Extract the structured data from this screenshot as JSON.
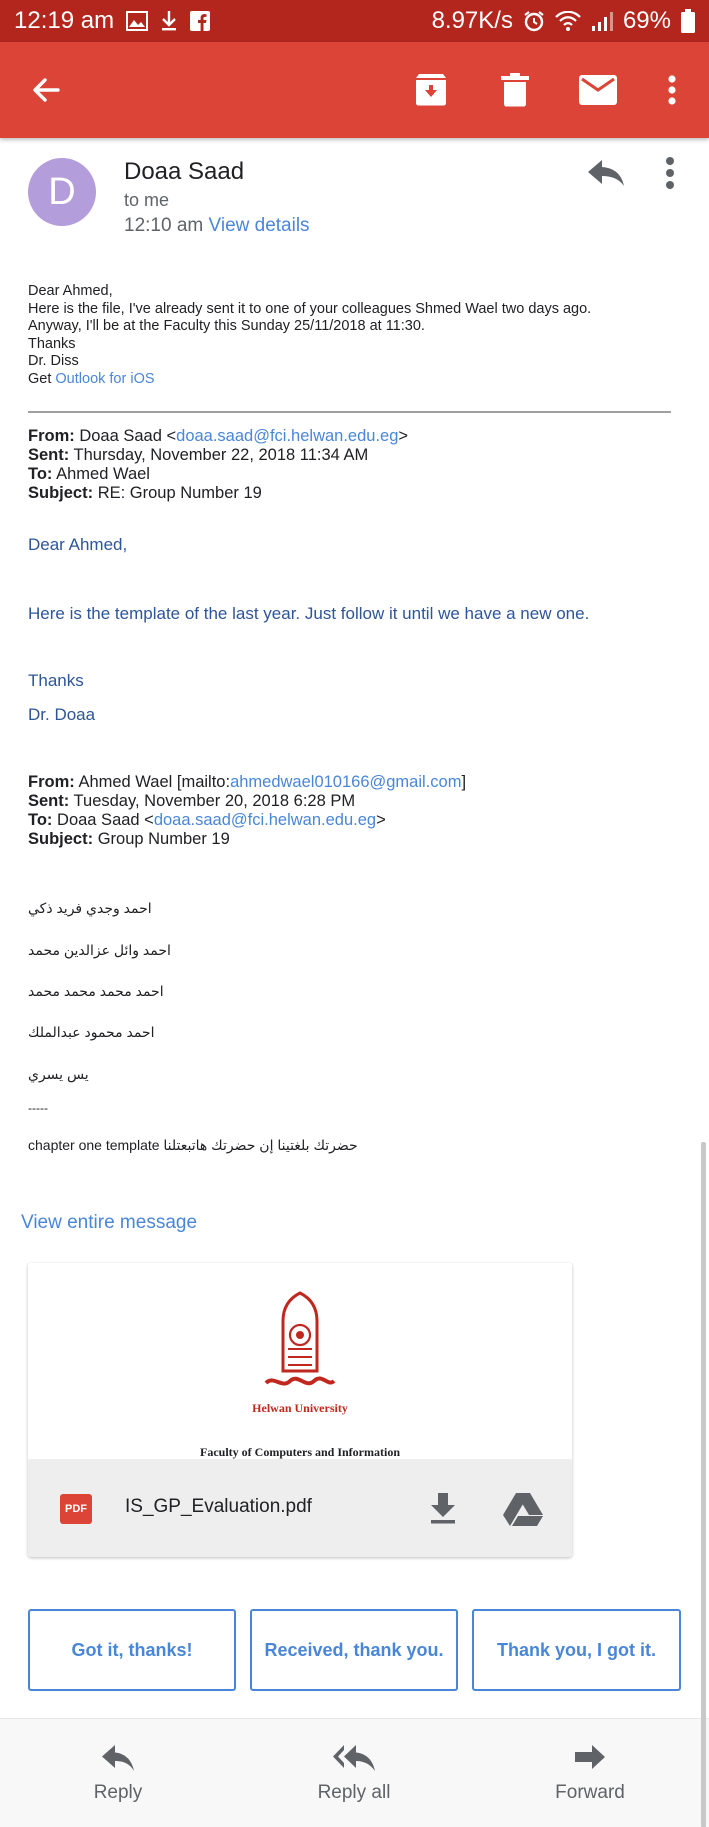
{
  "status_bar": {
    "time": "12:19 am",
    "network_speed": "8.97K/s",
    "battery": "69%"
  },
  "app_bar": {
    "icons": [
      "back-arrow-icon",
      "archive-icon",
      "delete-icon",
      "mail-icon",
      "more-vert-icon"
    ]
  },
  "header": {
    "avatar_letter": "D",
    "avatar_color": "#b39ddb",
    "sender": "Doaa Saad",
    "recipient": "to me",
    "time": "12:10 am",
    "view_details": "View details"
  },
  "reply_body": {
    "greeting": "Dear Ahmed,",
    "line1": "Here is the file, I've already sent it to one of your colleagues Shmed Wael two days ago.",
    "line2": "Anyway, I'll be at the Faculty this Sunday 25/11/2018 at 11:30.",
    "thanks": "Thanks",
    "signature": "Dr. Diss",
    "get_prefix": "Get",
    "outlook_link": "Outlook for iOS"
  },
  "quoted1": {
    "from_label": "From:",
    "from_name": "Doaa Saad <",
    "from_email": "doaa.saad@fci.helwan.edu.eg",
    "from_close": ">",
    "sent_label": "Sent:",
    "sent_value": "Thursday, November 22, 2018 11:34 AM",
    "to_label": "To:",
    "to_value": "Ahmed Wael",
    "subject_label": "Subject:",
    "subject_value": "RE: Group Number 19",
    "greeting": "Dear Ahmed,",
    "body": "Here is the template of the last year. Just follow it until we have a new one.",
    "thanks": "Thanks",
    "signature": "Dr. Doaa"
  },
  "quoted2": {
    "from_label": "From:",
    "from_name": "Ahmed Wael [mailto:",
    "from_email": "ahmedwael010166@gmail.com",
    "from_close": "]",
    "sent_label": "Sent:",
    "sent_value": "Tuesday, November 20, 2018 6:28 PM",
    "to_label": "To:",
    "to_name": "Doaa Saad <",
    "to_email": "doaa.saad@fci.helwan.edu.eg",
    "to_close": ">",
    "subject_label": "Subject:",
    "subject_value": "Group Number 19",
    "members": [
      "احمد وجدي فريد ذكي",
      "احمد وائل عزالدين محمد",
      "احمد محمد محمد محمد",
      "احمد محمود عبدالملك",
      "يس يسري"
    ],
    "separator": "-----",
    "request": "حضرتك بلغتينا إن حضرتك هاتبعتلنا chapter one template"
  },
  "view_entire": "View entire message",
  "attachment": {
    "type_badge": "PDF",
    "filename": "IS_GP_Evaluation.pdf",
    "preview_title": "Helwan University",
    "preview_subtitle": "Faculty of Computers and Information"
  },
  "smart_replies": [
    "Got it, thanks!",
    "Received, thank you.",
    "Thank you, I got it."
  ],
  "bottom_actions": {
    "reply": "Reply",
    "reply_all": "Reply all",
    "forward": "Forward"
  },
  "colors": {
    "app_bar": "#db4437",
    "status_bar": "#b3261e",
    "link": "#4a86d8",
    "quoted_text": "#2e5597"
  }
}
